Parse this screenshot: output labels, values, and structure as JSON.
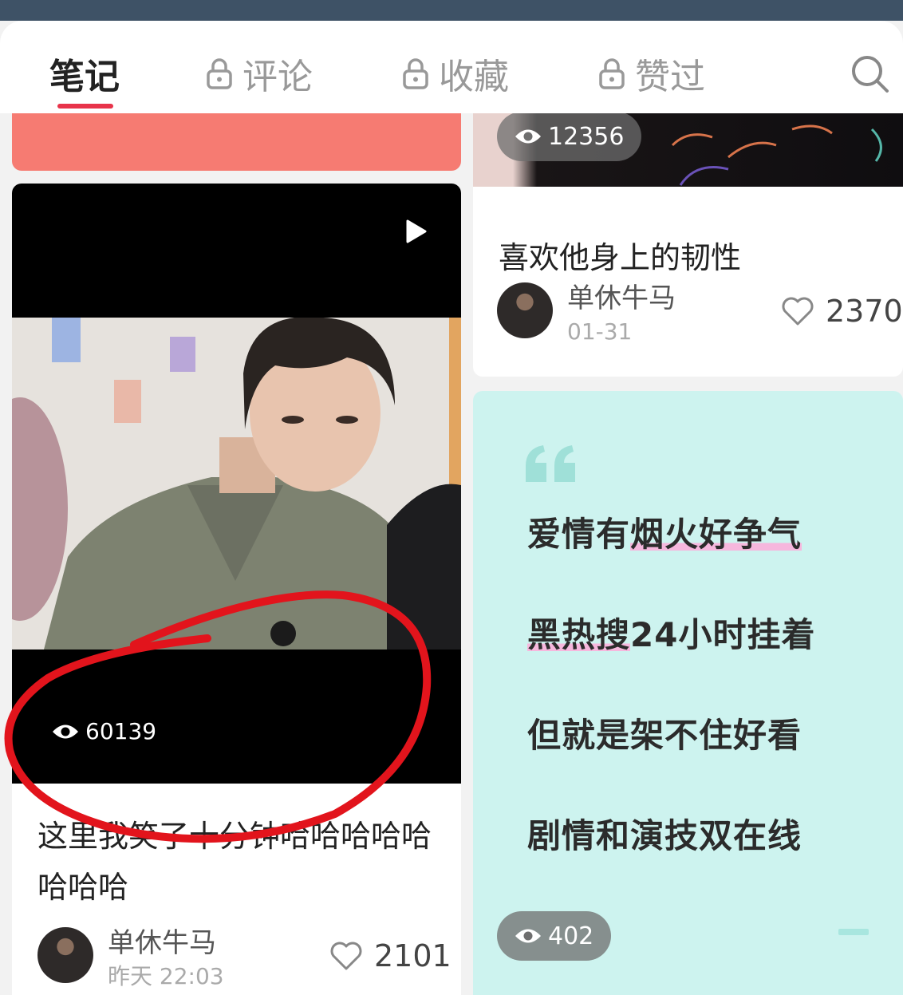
{
  "tabs": [
    {
      "label": "笔记",
      "locked": false,
      "active": true
    },
    {
      "label": "评论",
      "locked": true,
      "active": false
    },
    {
      "label": "收藏",
      "locked": true,
      "active": false
    },
    {
      "label": "赞过",
      "locked": true,
      "active": false
    }
  ],
  "left_column": {
    "video_note": {
      "views": "60139",
      "title": "这里我笑了十分钟哈哈哈哈哈哈哈哈",
      "author": "单休牛马",
      "time": "昨天 22:03",
      "likes": "2101"
    }
  },
  "right_column": {
    "image_note": {
      "views": "12356",
      "title": "喜欢他身上的韧性",
      "author": "单休牛马",
      "time": "01-31",
      "likes": "2370"
    },
    "quote_note": {
      "lines": [
        {
          "text": "爱情有烟火好争气",
          "highlight": "烟火好争气"
        },
        {
          "text": "黑热搜24小时挂着",
          "highlight": "黑热搜"
        },
        {
          "text": "但就是架不住好看",
          "highlight": ""
        },
        {
          "text": "剧情和演技双在线",
          "highlight": ""
        }
      ],
      "views": "402"
    }
  },
  "colors": {
    "accent": "#e8334a",
    "salmon_card": "#f67b72",
    "quote_bg": "#cdf3ef",
    "annotation": "#e2141c"
  },
  "icons": [
    "lock-icon",
    "search-icon",
    "play-icon",
    "eye-icon",
    "heart-icon",
    "quote-mark-icon"
  ]
}
